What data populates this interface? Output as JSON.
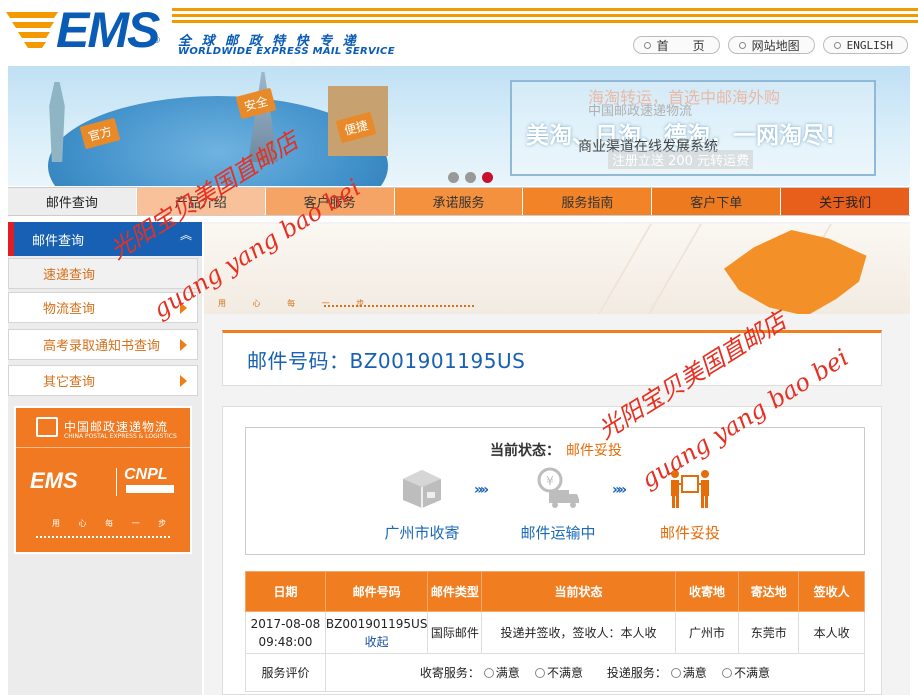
{
  "header": {
    "logo_text": "EMS",
    "logo_reg": "®",
    "name_cn": "全 球 邮 政 特 快 专 递",
    "name_en": "WORLDWIDE EXPRESS MAIL SERVICE",
    "links": [
      {
        "label": "首　　页"
      },
      {
        "label": "网站地图"
      },
      {
        "label": "ENGLISH"
      }
    ]
  },
  "banner": {
    "line1": "海淘转运，首选中邮海外购",
    "line1b": "中国邮政速递物流",
    "line2": "美淘、日淘、德淘，一网淘尽!",
    "line3": "商业渠道在线发展系统",
    "line4": "注册立送 200 元转运费",
    "tags": [
      "官方",
      "安全",
      "便捷"
    ]
  },
  "nav": {
    "items": [
      "邮件查询",
      "产品介绍",
      "客户服务",
      "承诺服务",
      "服务指南",
      "客户下单",
      "关于我们"
    ]
  },
  "sidebar": {
    "header": "邮件查询",
    "items": [
      "速递查询",
      "物流查询",
      "高考录取通知书查询",
      "其它查询"
    ],
    "ad": {
      "company_cn": "中国邮政速递物流",
      "company_en": "CHINA POSTAL EXPRESS & LOGISTICS",
      "ems": "EMS",
      "cnpl": "CNPL",
      "slogan": "用 心 每 一 步"
    }
  },
  "main": {
    "banner_slogan": "用 心 每 一 步",
    "tracking_label": "邮件号码：BZ001901195US",
    "status_label": "当前状态：",
    "status_value": "邮件妥投",
    "steps": [
      "广州市收寄",
      "邮件运输中",
      "邮件妥投"
    ],
    "arrow": "»»",
    "table": {
      "headers": [
        "日期",
        "邮件号码",
        "邮件类型",
        "当前状态",
        "收寄地",
        "寄达地",
        "签收人"
      ],
      "row": {
        "date": "2017-08-08 09:48:00",
        "number": "BZ001901195US",
        "collapse": "收起",
        "type": "国际邮件",
        "status": "投递并签收，签收人：本人收",
        "origin": "广州市",
        "destination": "东莞市",
        "signer": "本人收"
      },
      "eval": {
        "label": "服务评价",
        "collect_label": "收寄服务：",
        "deliver_label": "投递服务：",
        "satisfied": "满意",
        "unsatisfied": "不满意"
      }
    }
  },
  "watermarks": {
    "cn": "光阳宝贝美国直邮店",
    "en": "guang yang bao bei"
  },
  "colors": {
    "brand_blue": "#0a5bb6",
    "brand_orange": "#f07d1f",
    "status_orange": "#e46c0a",
    "watermark_red": "#e63022"
  }
}
